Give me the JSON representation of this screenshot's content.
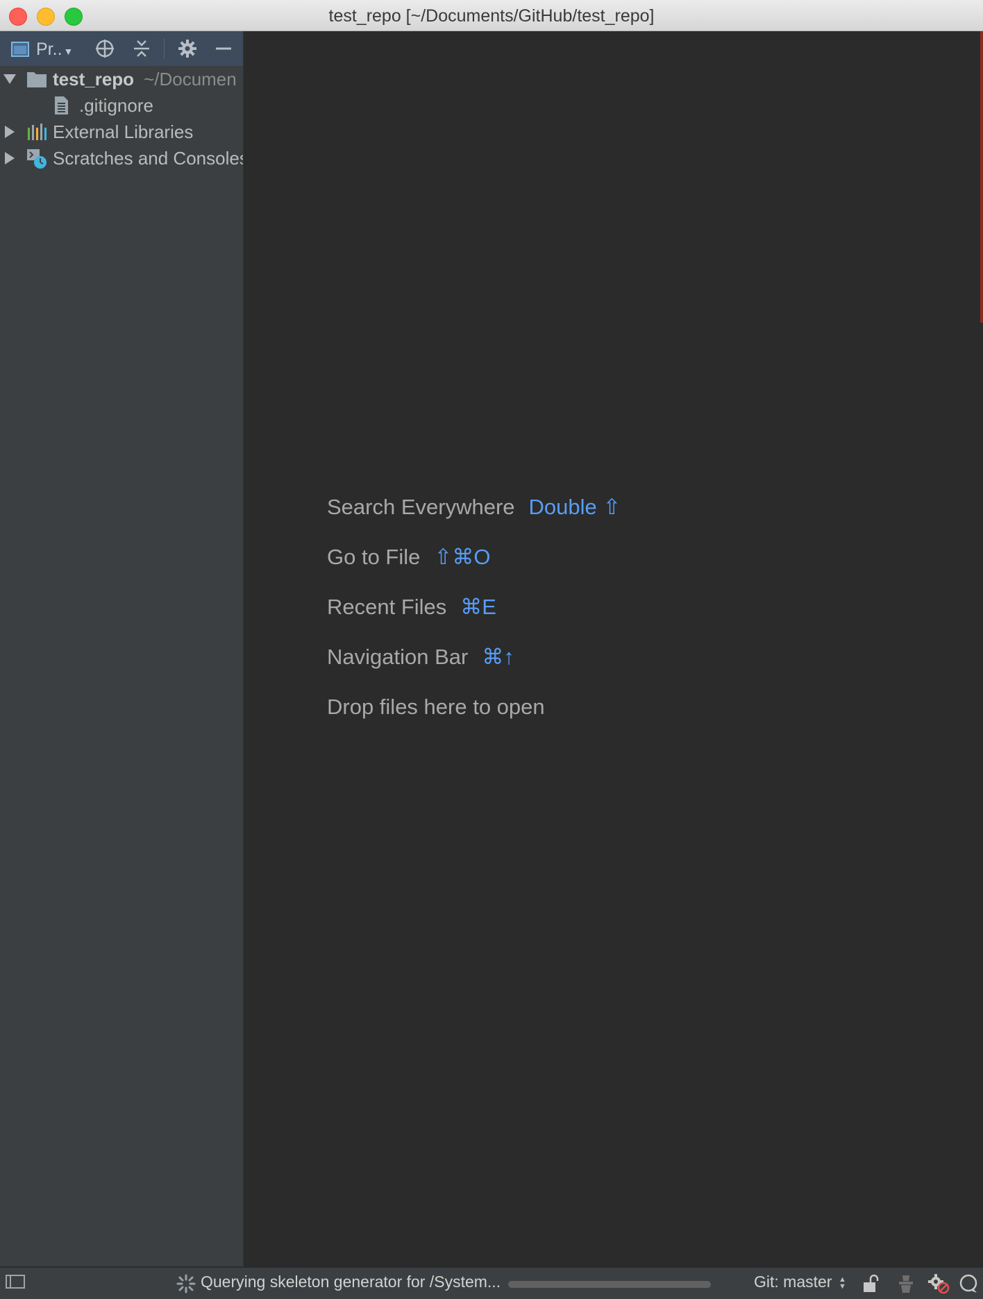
{
  "window": {
    "title": "test_repo [~/Documents/GitHub/test_repo]"
  },
  "toolwindow": {
    "view_label": "Pr..",
    "buttons": [
      "locate-icon",
      "collapse-all-icon",
      "gear-icon",
      "minimize-icon"
    ]
  },
  "tree": {
    "root": {
      "name": "test_repo",
      "path": "~/Documen"
    },
    "file": {
      "name": ".gitignore"
    },
    "libs": {
      "name": "External Libraries"
    },
    "scratches": {
      "name": "Scratches and Consoles"
    }
  },
  "hints": [
    {
      "label": "Search Everywhere",
      "key": "Double ⇧"
    },
    {
      "label": "Go to File",
      "key": "⇧⌘O"
    },
    {
      "label": "Recent Files",
      "key": "⌘E"
    },
    {
      "label": "Navigation Bar",
      "key": "⌘↑"
    },
    {
      "label": "Drop files here to open",
      "key": ""
    }
  ],
  "status": {
    "task": "Querying skeleton generator for /System...",
    "progress": 0.0,
    "git": "Git: master"
  },
  "colors": {
    "accent_key": "#589df6",
    "sidebar_bg": "#3c3f41",
    "editor_bg": "#2b2b2b"
  }
}
